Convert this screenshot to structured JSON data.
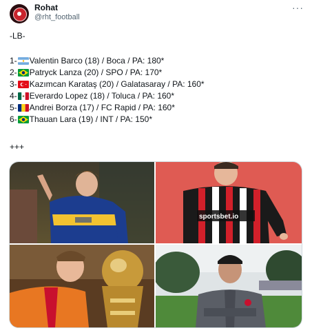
{
  "tweet": {
    "author_name": "Rohat",
    "author_handle": "@rht_football",
    "more_label": "···",
    "header": "-LB-",
    "footer": "+++",
    "players": [
      {
        "index": "1-",
        "flag": "argentina-flag",
        "text": "Valentin Barco (18) / Boca / PA: 180*"
      },
      {
        "index": "2-",
        "flag": "brazil-flag",
        "text": "Patryck Lanza (20) / SPO / PA: 170*"
      },
      {
        "index": "3-",
        "flag": "turkey-flag",
        "text": "Kazımcan Karataş (20) / Galatasaray / PA: 160*"
      },
      {
        "index": "4-",
        "flag": "mexico-flag",
        "text": "Everardo Lopez (18) / Toluca / PA: 160*"
      },
      {
        "index": "5-",
        "flag": "romania-flag",
        "text": "Andrei Borza (17) / FC Rapid / PA: 160*"
      },
      {
        "index": "6-",
        "flag": "brazil-flag",
        "text": "Thauan Lara (19) / INT / PA: 150*"
      }
    ],
    "photos": {
      "top_right_sponsor": "sportsbet.io"
    }
  },
  "colors": {
    "boca_blue": "#1c3d8f",
    "boca_gold": "#f2c230",
    "sao_paulo_red": "#d2202a",
    "galatasaray_orange": "#e87722",
    "toluca_red": "#c8102e"
  }
}
